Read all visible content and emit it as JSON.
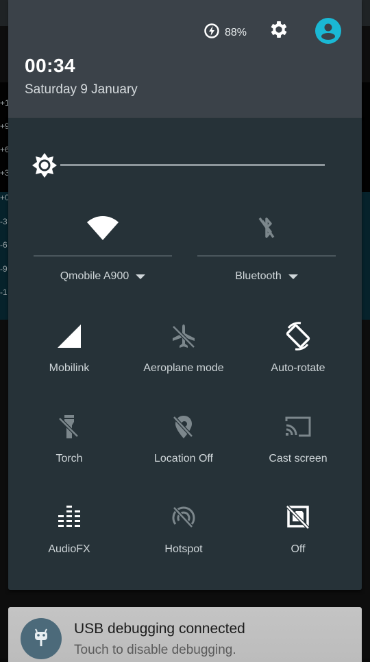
{
  "status": {
    "battery_percent": "88%",
    "battery_icon": "battery-charging-icon",
    "settings_icon": "gear-icon",
    "user_icon": "user-avatar-icon"
  },
  "header": {
    "time": "00:34",
    "date": "Saturday 9 January"
  },
  "brightness": {
    "icon": "brightness-icon",
    "level": 0.0
  },
  "big_tiles": [
    {
      "label": "Qmobile A900",
      "icon": "wifi-icon",
      "state": "on"
    },
    {
      "label": "Bluetooth",
      "icon": "bluetooth-off-icon",
      "state": "off"
    }
  ],
  "tiles": [
    {
      "label": "Mobilink",
      "icon": "cellular-signal-icon",
      "state": "on"
    },
    {
      "label": "Aeroplane mode",
      "icon": "airplane-off-icon",
      "state": "off"
    },
    {
      "label": "Auto-rotate",
      "icon": "auto-rotate-icon",
      "state": "on"
    },
    {
      "label": "Torch",
      "icon": "torch-off-icon",
      "state": "off"
    },
    {
      "label": "Location Off",
      "icon": "location-off-icon",
      "state": "off"
    },
    {
      "label": "Cast screen",
      "icon": "cast-icon",
      "state": "off"
    },
    {
      "label": "AudioFX",
      "icon": "equalizer-icon",
      "state": "on"
    },
    {
      "label": "Hotspot",
      "icon": "hotspot-off-icon",
      "state": "off"
    },
    {
      "label": "Off",
      "icon": "screenshot-off-icon",
      "state": "on"
    }
  ],
  "notification": {
    "title": "USB debugging connected",
    "subtitle": "Touch to disable debugging.",
    "icon": "cyanogenmod-bot-icon"
  },
  "background_labels": [
    "+1",
    "+9",
    "+6",
    "+3",
    "+0",
    "-3",
    "-6",
    "-9",
    "-1"
  ],
  "colors": {
    "accent": "#1ab8d4",
    "panel": "#263238",
    "header": "#3b4249",
    "active_icon": "#ffffff",
    "inactive_icon": "#7c878c"
  }
}
